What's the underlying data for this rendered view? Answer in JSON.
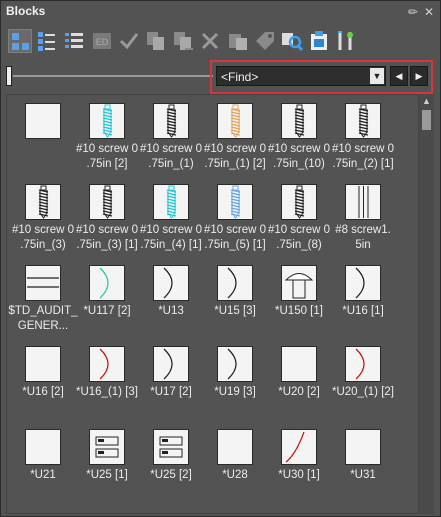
{
  "window": {
    "title": "Blocks"
  },
  "toolbar": {
    "tools": [
      {
        "icon": "large-icons-view-icon",
        "active": true
      },
      {
        "icon": "small-icons-view-icon"
      },
      {
        "icon": "list-view-icon"
      },
      {
        "icon": "block-editor-icon"
      },
      {
        "icon": "checkmark-icon"
      },
      {
        "icon": "copy-block-icon"
      },
      {
        "icon": "move-block-icon"
      },
      {
        "icon": "delete-icon"
      },
      {
        "icon": "paste-block-icon"
      },
      {
        "icon": "rename-tag-icon"
      },
      {
        "icon": "find-block-icon"
      },
      {
        "icon": "insert-block-icon"
      },
      {
        "icon": "tools-icon"
      }
    ]
  },
  "find": {
    "value": "<Find>"
  },
  "blocks": [
    {
      "label": "",
      "glyph": "blank"
    },
    {
      "label": "#10 screw 0\n.75in [2]",
      "glyph": "screw",
      "color": "#1fc8d8"
    },
    {
      "label": "#10 screw 0\n.75in_(1)",
      "glyph": "screw",
      "color": "#222222"
    },
    {
      "label": "#10 screw 0\n.75in_(1) [2]",
      "glyph": "screw",
      "color": "#e6a15a"
    },
    {
      "label": "#10 screw 0\n.75in_(10)",
      "glyph": "screw",
      "color": "#222222"
    },
    {
      "label": "#10 screw 0\n.75in_(2) [1]",
      "glyph": "screw",
      "color": "#222222"
    },
    {
      "label": "#10 screw 0\n.75in_(3)",
      "glyph": "screw",
      "color": "#222222"
    },
    {
      "label": "#10 screw 0\n.75in_(3) [1]",
      "glyph": "screw",
      "color": "#222222"
    },
    {
      "label": "#10 screw 0\n.75in_(4) [1]",
      "glyph": "screw",
      "color": "#1fc8d8"
    },
    {
      "label": "#10 screw 0\n.75in_(5) [1]",
      "glyph": "screw",
      "color": "#63a6e8"
    },
    {
      "label": "#10 screw 0\n.75in_(8)",
      "glyph": "screw",
      "color": "#222222"
    },
    {
      "label": "#8 screw1.\n5in",
      "glyph": "shank"
    },
    {
      "label": "$TD_AUDIT_\nGENER...",
      "glyph": "audit"
    },
    {
      "label": "*U117 [2]",
      "glyph": "arc",
      "color": "#29c6a5"
    },
    {
      "label": "*U13",
      "glyph": "arc",
      "color": "#222222"
    },
    {
      "label": "*U15 [3]",
      "glyph": "arc",
      "color": "#222222"
    },
    {
      "label": "*U150 [1]",
      "glyph": "mushroom"
    },
    {
      "label": "*U16 [1]",
      "glyph": "arc",
      "color": "#222222"
    },
    {
      "label": "*U16 [2]",
      "glyph": "blank"
    },
    {
      "label": "*U16_(1) [3]",
      "glyph": "arc",
      "color": "#cc1111"
    },
    {
      "label": "*U17 [2]",
      "glyph": "arc",
      "color": "#222222"
    },
    {
      "label": "*U19 [3]",
      "glyph": "arc",
      "color": "#222222"
    },
    {
      "label": "*U20 [2]",
      "glyph": "blank"
    },
    {
      "label": "*U20_(1) [2]",
      "glyph": "arc",
      "color": "#cc1111"
    },
    {
      "label": "*U21",
      "glyph": "blank"
    },
    {
      "label": "*U25 [1]",
      "glyph": "bars"
    },
    {
      "label": "*U25 [2]",
      "glyph": "bars"
    },
    {
      "label": "*U28",
      "glyph": "blank"
    },
    {
      "label": "*U30 [1]",
      "glyph": "curve",
      "color": "#cc1111"
    },
    {
      "label": "*U31",
      "glyph": "blank"
    }
  ]
}
